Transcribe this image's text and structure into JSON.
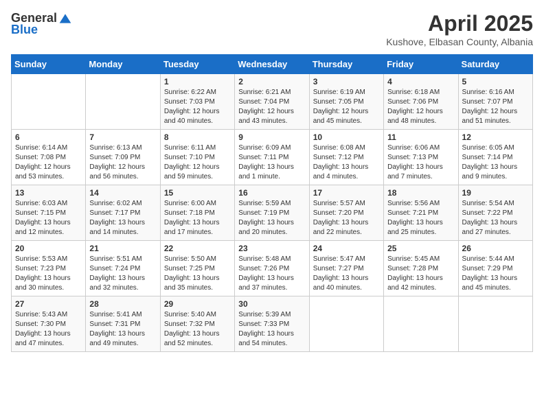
{
  "logo": {
    "general": "General",
    "blue": "Blue"
  },
  "header": {
    "month": "April 2025",
    "location": "Kushove, Elbasan County, Albania"
  },
  "weekdays": [
    "Sunday",
    "Monday",
    "Tuesday",
    "Wednesday",
    "Thursday",
    "Friday",
    "Saturday"
  ],
  "weeks": [
    [
      {
        "day": "",
        "info": ""
      },
      {
        "day": "",
        "info": ""
      },
      {
        "day": "1",
        "info": "Sunrise: 6:22 AM\nSunset: 7:03 PM\nDaylight: 12 hours\nand 40 minutes."
      },
      {
        "day": "2",
        "info": "Sunrise: 6:21 AM\nSunset: 7:04 PM\nDaylight: 12 hours\nand 43 minutes."
      },
      {
        "day": "3",
        "info": "Sunrise: 6:19 AM\nSunset: 7:05 PM\nDaylight: 12 hours\nand 45 minutes."
      },
      {
        "day": "4",
        "info": "Sunrise: 6:18 AM\nSunset: 7:06 PM\nDaylight: 12 hours\nand 48 minutes."
      },
      {
        "day": "5",
        "info": "Sunrise: 6:16 AM\nSunset: 7:07 PM\nDaylight: 12 hours\nand 51 minutes."
      }
    ],
    [
      {
        "day": "6",
        "info": "Sunrise: 6:14 AM\nSunset: 7:08 PM\nDaylight: 12 hours\nand 53 minutes."
      },
      {
        "day": "7",
        "info": "Sunrise: 6:13 AM\nSunset: 7:09 PM\nDaylight: 12 hours\nand 56 minutes."
      },
      {
        "day": "8",
        "info": "Sunrise: 6:11 AM\nSunset: 7:10 PM\nDaylight: 12 hours\nand 59 minutes."
      },
      {
        "day": "9",
        "info": "Sunrise: 6:09 AM\nSunset: 7:11 PM\nDaylight: 13 hours\nand 1 minute."
      },
      {
        "day": "10",
        "info": "Sunrise: 6:08 AM\nSunset: 7:12 PM\nDaylight: 13 hours\nand 4 minutes."
      },
      {
        "day": "11",
        "info": "Sunrise: 6:06 AM\nSunset: 7:13 PM\nDaylight: 13 hours\nand 7 minutes."
      },
      {
        "day": "12",
        "info": "Sunrise: 6:05 AM\nSunset: 7:14 PM\nDaylight: 13 hours\nand 9 minutes."
      }
    ],
    [
      {
        "day": "13",
        "info": "Sunrise: 6:03 AM\nSunset: 7:15 PM\nDaylight: 13 hours\nand 12 minutes."
      },
      {
        "day": "14",
        "info": "Sunrise: 6:02 AM\nSunset: 7:17 PM\nDaylight: 13 hours\nand 14 minutes."
      },
      {
        "day": "15",
        "info": "Sunrise: 6:00 AM\nSunset: 7:18 PM\nDaylight: 13 hours\nand 17 minutes."
      },
      {
        "day": "16",
        "info": "Sunrise: 5:59 AM\nSunset: 7:19 PM\nDaylight: 13 hours\nand 20 minutes."
      },
      {
        "day": "17",
        "info": "Sunrise: 5:57 AM\nSunset: 7:20 PM\nDaylight: 13 hours\nand 22 minutes."
      },
      {
        "day": "18",
        "info": "Sunrise: 5:56 AM\nSunset: 7:21 PM\nDaylight: 13 hours\nand 25 minutes."
      },
      {
        "day": "19",
        "info": "Sunrise: 5:54 AM\nSunset: 7:22 PM\nDaylight: 13 hours\nand 27 minutes."
      }
    ],
    [
      {
        "day": "20",
        "info": "Sunrise: 5:53 AM\nSunset: 7:23 PM\nDaylight: 13 hours\nand 30 minutes."
      },
      {
        "day": "21",
        "info": "Sunrise: 5:51 AM\nSunset: 7:24 PM\nDaylight: 13 hours\nand 32 minutes."
      },
      {
        "day": "22",
        "info": "Sunrise: 5:50 AM\nSunset: 7:25 PM\nDaylight: 13 hours\nand 35 minutes."
      },
      {
        "day": "23",
        "info": "Sunrise: 5:48 AM\nSunset: 7:26 PM\nDaylight: 13 hours\nand 37 minutes."
      },
      {
        "day": "24",
        "info": "Sunrise: 5:47 AM\nSunset: 7:27 PM\nDaylight: 13 hours\nand 40 minutes."
      },
      {
        "day": "25",
        "info": "Sunrise: 5:45 AM\nSunset: 7:28 PM\nDaylight: 13 hours\nand 42 minutes."
      },
      {
        "day": "26",
        "info": "Sunrise: 5:44 AM\nSunset: 7:29 PM\nDaylight: 13 hours\nand 45 minutes."
      }
    ],
    [
      {
        "day": "27",
        "info": "Sunrise: 5:43 AM\nSunset: 7:30 PM\nDaylight: 13 hours\nand 47 minutes."
      },
      {
        "day": "28",
        "info": "Sunrise: 5:41 AM\nSunset: 7:31 PM\nDaylight: 13 hours\nand 49 minutes."
      },
      {
        "day": "29",
        "info": "Sunrise: 5:40 AM\nSunset: 7:32 PM\nDaylight: 13 hours\nand 52 minutes."
      },
      {
        "day": "30",
        "info": "Sunrise: 5:39 AM\nSunset: 7:33 PM\nDaylight: 13 hours\nand 54 minutes."
      },
      {
        "day": "",
        "info": ""
      },
      {
        "day": "",
        "info": ""
      },
      {
        "day": "",
        "info": ""
      }
    ]
  ]
}
